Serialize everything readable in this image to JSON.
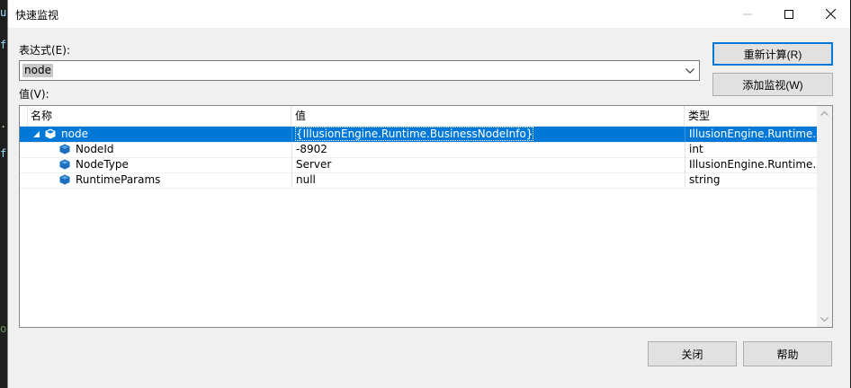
{
  "window": {
    "title": "快速监视",
    "minimize_icon": "minimize-icon",
    "maximize_icon": "maximize-icon",
    "close_icon": "close-icon"
  },
  "expression": {
    "label": "表达式(E):",
    "value": "node"
  },
  "value_label": "值(V):",
  "buttons": {
    "reevaluate": "重新计算(R)",
    "add_watch": "添加监视(W)",
    "close": "关闭",
    "help": "帮助"
  },
  "grid": {
    "columns": [
      "名称",
      "值",
      "类型"
    ],
    "rows": [
      {
        "name": "node",
        "value": "{IllusionEngine.Runtime.BusinessNodeInfo}",
        "type": "IllusionEngine.Runtime....",
        "selected": true,
        "expanded": true,
        "level": 0
      },
      {
        "name": "NodeId",
        "value": "-8902",
        "type": "int",
        "selected": false,
        "level": 1
      },
      {
        "name": "NodeType",
        "value": "Server",
        "type": "IllusionEngine.Runtime....",
        "selected": false,
        "level": 1
      },
      {
        "name": "RuntimeParams",
        "value": "null",
        "type": "string",
        "selected": false,
        "level": 1
      }
    ]
  },
  "colors": {
    "selection": "#0078d7",
    "default_button_border": "#0078d7",
    "cube_icon": "#1c6fbf"
  }
}
